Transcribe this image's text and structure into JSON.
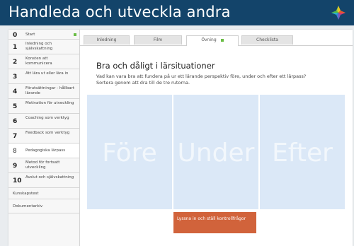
{
  "app": {
    "title": "Handleda och utveckla andra",
    "logo_icon": "colorful-star-logo"
  },
  "sidebar": {
    "items": [
      {
        "num": "0",
        "label": "Start",
        "done": true
      },
      {
        "num": "1",
        "label": "Inledning och självskattning"
      },
      {
        "num": "2",
        "label": "Konsten att kommunicera"
      },
      {
        "num": "3",
        "label": "Att lära ut eller lära in"
      },
      {
        "num": "4",
        "label": "Förutsättningar - hållbart lärande"
      },
      {
        "num": "5",
        "label": "Motivation för utveckling"
      },
      {
        "num": "6",
        "label": "Coaching som verktyg"
      },
      {
        "num": "7",
        "label": "Feedback som verktyg"
      },
      {
        "num": "8",
        "label": "Pedagogiska lärpass",
        "active": true
      },
      {
        "num": "9",
        "label": "Metod för fortsatt utveckling"
      },
      {
        "num": "10",
        "label": "Avslut och självskattning"
      }
    ],
    "extras": [
      "Kunskapstest",
      "Dokumentarkiv"
    ]
  },
  "tabs": [
    {
      "label": "Inledning"
    },
    {
      "label": "Film"
    },
    {
      "label": "Övning",
      "active": true,
      "done": true
    },
    {
      "label": "Checklista"
    }
  ],
  "exercise": {
    "heading": "Bra och dåligt i lärsituationer",
    "instructions": "Vad kan vara bra att fundera på ur ett lärande perspektiv före, under och efter ett lärpass? Sortera genom att dra till de tre rutorna.",
    "zones": [
      "Före",
      "Under",
      "Efter"
    ],
    "card": "Lyssna in och ställ kontrollfrågor"
  },
  "colors": {
    "header_bg": "#13446a",
    "zone_bg": "#dbe8f7",
    "card_bg": "#d1633b",
    "done_marker": "#6abd45"
  }
}
